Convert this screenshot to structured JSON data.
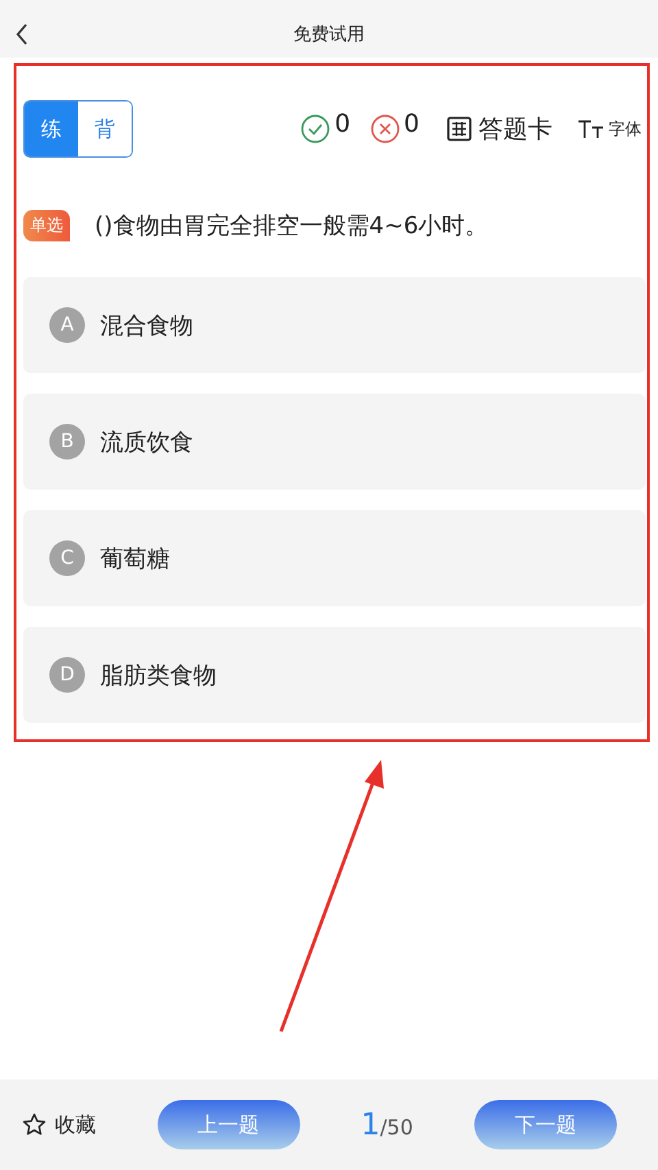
{
  "header": {
    "title": "免费试用"
  },
  "modes": [
    {
      "label": "练",
      "selected": true
    },
    {
      "label": "背",
      "selected": false
    }
  ],
  "stats": {
    "correct": "0",
    "wrong": "0",
    "answer_card": "答题卡",
    "font": "字体"
  },
  "question": {
    "type": "单选",
    "text": "()食物由胃完全排空一般需4~6小时。"
  },
  "options": [
    {
      "letter": "A",
      "text": "混合食物",
      "selected": false
    },
    {
      "letter": "B",
      "text": "流质饮食",
      "selected": false
    },
    {
      "letter": "C",
      "text": "葡萄糖",
      "selected": false
    },
    {
      "letter": "D",
      "text": "脂肪类食物",
      "selected": false
    }
  ],
  "footer": {
    "favorite": "收藏",
    "prev": "上一题",
    "current": "1",
    "total": "/50",
    "next": "下一题"
  }
}
